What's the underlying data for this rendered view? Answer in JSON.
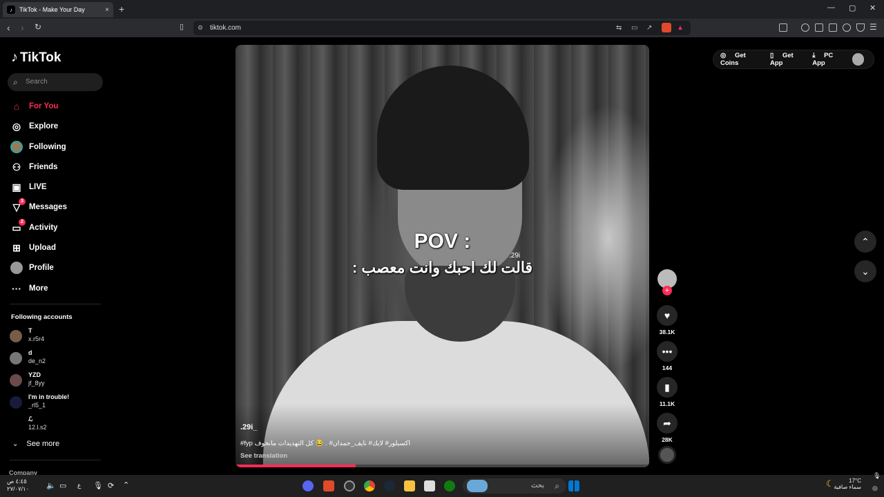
{
  "browser": {
    "tab_title": "TikTok - Make Your Day",
    "tab_close": "×",
    "new_tab": "+",
    "url": "tiktok.com",
    "win_min": "—",
    "win_max": "▢",
    "win_close": "✕"
  },
  "sidebar": {
    "logo": "TikTok",
    "search_placeholder": "Search",
    "nav": [
      {
        "label": "For You",
        "icon": "home-icon",
        "active": true
      },
      {
        "label": "Explore",
        "icon": "compass-icon"
      },
      {
        "label": "Following",
        "icon": "following-avatar-icon"
      },
      {
        "label": "Friends",
        "icon": "friends-icon"
      },
      {
        "label": "LIVE",
        "icon": "live-icon"
      },
      {
        "label": "Messages",
        "icon": "messages-icon",
        "badge": "3"
      },
      {
        "label": "Activity",
        "icon": "activity-icon",
        "badge": "2"
      },
      {
        "label": "Upload",
        "icon": "upload-icon"
      },
      {
        "label": "Profile",
        "icon": "profile-icon"
      },
      {
        "label": "More",
        "icon": "more-icon"
      }
    ],
    "following_title": "Following accounts",
    "accounts": [
      {
        "name": "T",
        "handle": "x.r5r4"
      },
      {
        "name": "d",
        "handle": "de_n2"
      },
      {
        "name": "YZD",
        "handle": "jf_8yy"
      },
      {
        "name": "I'm in trouble!",
        "handle": "_rl5_1"
      },
      {
        "name": "ℒ",
        "handle": "12.l.s2"
      }
    ],
    "see_more": "See more",
    "company": "Company"
  },
  "video": {
    "overlay_title": "POV :",
    "overlay_text": "قالت لك احبك وانت معصب :",
    "watermark": ".29i",
    "author": ".29i_",
    "caption": "#fyp اكسبلور# لايك# نايف_حمدان# . 😂 كل التهديدات مانخوف",
    "see_translation": "See translation",
    "progress": 0.29
  },
  "actions": {
    "likes": "38.1K",
    "comments": "144",
    "saves": "11.1K",
    "shares": "28K"
  },
  "topbar": {
    "get_coins": "Get Coins",
    "get_app": "Get App",
    "pc_app": "PC App"
  },
  "taskbar": {
    "search_text": "بحث",
    "time": "٤:٤٥ ص",
    "date": "٢٧/٠٧/١٠",
    "weather_temp": "17°C",
    "weather_text": "سماء صافية",
    "lang": "ع"
  }
}
